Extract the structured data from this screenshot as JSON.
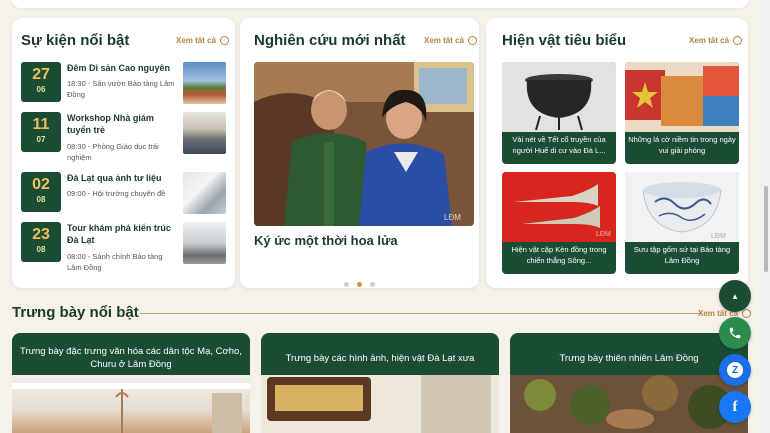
{
  "events_card": {
    "title": "Sự kiện nổi bật",
    "view_all": "Xem tất cả",
    "items": [
      {
        "day": "27",
        "month": "06",
        "title": "Đêm Di sản Cao nguyên",
        "meta": "18:30 - Sân vườn Bảo tàng Lâm Đồng"
      },
      {
        "day": "11",
        "month": "07",
        "title": "Workshop Nhà giám tuyển trẻ",
        "meta": "08:30 - Phòng Giáo dục trải nghiệm"
      },
      {
        "day": "02",
        "month": "08",
        "title": "Đà Lạt qua ảnh tư liệu",
        "meta": "09:00 - Hội trường chuyên đề"
      },
      {
        "day": "23",
        "month": "08",
        "title": "Tour khám phá kiến trúc Đà Lạt",
        "meta": "08:00 - Sảnh chính Bảo tàng Lâm Đồng"
      }
    ]
  },
  "research_card": {
    "title": "Nghiên cứu mới nhất",
    "view_all": "Xem tất cả",
    "featured_caption": "Ký ức một thời hoa lửa",
    "slides": 3,
    "active_slide": 2
  },
  "artifacts_card": {
    "title": "Hiện vật tiêu biểu",
    "view_all": "Xem tất cả",
    "items": [
      {
        "caption": "Vài nét về Tết cổ truyền của người Huế di cư vào Đà L..."
      },
      {
        "caption": "Những lá cờ niềm tin trong ngày vui giải phóng"
      },
      {
        "caption": "Hiện vật cặp Kèn đồng trong chiến thắng Sông..."
      },
      {
        "caption": "Sưu tập gốm sứ tại Bảo tàng Lâm Đồng"
      }
    ]
  },
  "exhibitions": {
    "title": "Trưng bày nổi bật",
    "view_all": "Xem tất cả",
    "items": [
      {
        "title": "Trưng bày đặc trưng văn hóa các dân tộc Mạ, Cơho, Churu ở Lâm Đồng"
      },
      {
        "title": "Trưng bày các hình ảnh, hiện vật Đà Lạt xưa"
      },
      {
        "title": "Trưng bày thiên nhiên Lâm Đồng"
      }
    ]
  },
  "floating_buttons": {
    "top_icon": "arrow-up-icon",
    "phone_icon": "phone-icon",
    "zalo_icon": "zalo-icon",
    "zalo_text": "Z",
    "facebook_icon": "facebook-icon",
    "facebook_text": "f"
  },
  "colors": {
    "primary_green": "#1b4d34",
    "accent_gold": "#b5823b",
    "zalo_blue": "#1a6fe6",
    "facebook_blue": "#1877f2",
    "background": "#f6f1ea"
  }
}
